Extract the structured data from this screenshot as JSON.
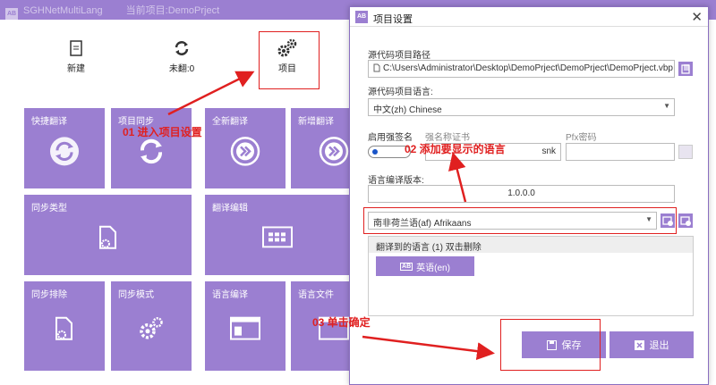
{
  "app": {
    "title": "SGHNetMultiLang",
    "subtitle": "当前项目:DemoPrject"
  },
  "toolbar": [
    {
      "label": "新建",
      "icon": "new-doc-icon"
    },
    {
      "label": "未翻:0",
      "icon": "refresh-icon"
    },
    {
      "label": "项目",
      "icon": "gears-icon"
    }
  ],
  "tiles": {
    "quick_translate": "快捷翻译",
    "project_sync": "项目同步",
    "full_translate": "全新翻译",
    "new_translate": "新增翻译",
    "sync_type": "同步类型",
    "translate_edit": "翻译编辑",
    "sync_exclude": "同步排除",
    "sync_mode": "同步模式",
    "lang_compile": "语言编译",
    "lang_file": "语言文件"
  },
  "annotations": {
    "step1": "01 进入项目设置",
    "step2": "02 添加要显示的语言",
    "step3": "03 单击确定"
  },
  "dialog": {
    "logo": "AB",
    "title": "项目设置",
    "close_glyph": "✕",
    "source_path_label": "源代码项目路径",
    "source_path_value": "C:\\Users\\Administrator\\Desktop\\DemoPrject\\DemoPrject\\DemoPrject.vbp",
    "source_lang_label": "源代码项目语言:",
    "source_lang_value": "中文(zh) Chinese",
    "strong_name_label": "启用强签名",
    "strong_cert_label": "强名称证书",
    "strong_cert_value": "snk",
    "pfx_label": "Pfx密码",
    "compile_ver_label": "语言编译版本:",
    "compile_ver_value": "1.0.0.0",
    "add_lang_value": "南非荷兰语(af) Afrikaans",
    "translated_langs_header": "翻译到的语言 (1) 双击删除",
    "translated_langs": [
      {
        "badge": "AB",
        "label": "英语(en)"
      }
    ],
    "save_label": "保存",
    "exit_label": "退出"
  },
  "colors": {
    "accent": "#9b7fd1",
    "annotation": "#e02020"
  }
}
